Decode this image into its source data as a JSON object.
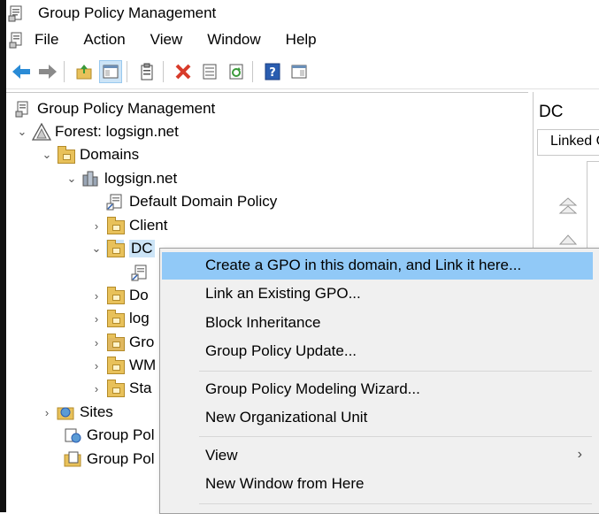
{
  "window": {
    "title": "Group Policy Management"
  },
  "menubar": {
    "items": [
      "File",
      "Action",
      "View",
      "Window",
      "Help"
    ]
  },
  "toolbar": {
    "icons": [
      "back-icon",
      "forward-icon",
      "up-folder-icon",
      "show-hide-tree-icon",
      "properties-icon",
      "delete-icon",
      "export-list-icon",
      "refresh-icon",
      "help-icon",
      "action-pane-icon"
    ]
  },
  "tree": {
    "root": "Group Policy Management",
    "forest": "Forest: logsign.net",
    "domains": "Domains",
    "domain": "logsign.net",
    "items": {
      "default_policy": "Default Domain Policy",
      "client": "Client",
      "dc": "DC",
      "do": "Do",
      "log": "log",
      "gro": "Gro",
      "wm": "WM",
      "sta": "Sta"
    },
    "sites": "Sites",
    "gp1": "Group Pol",
    "gp2": "Group Pol"
  },
  "right_pane": {
    "title": "DC",
    "tab": "Linked G"
  },
  "context_menu": {
    "items": [
      "Create a GPO in this domain, and Link it here...",
      "Link an Existing GPO...",
      "Block Inheritance",
      "Group Policy Update...",
      "Group Policy Modeling Wizard...",
      "New Organizational Unit",
      "View",
      "New Window from Here"
    ],
    "highlighted_index": 0,
    "submenu_arrow": "›"
  },
  "colors": {
    "highlight": "#91c9f7",
    "menu_bg": "#f0f0f0"
  }
}
